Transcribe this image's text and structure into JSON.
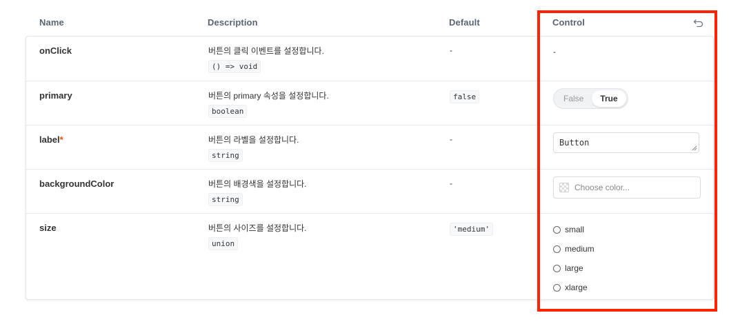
{
  "header": {
    "name": "Name",
    "description": "Description",
    "default": "Default",
    "control": "Control",
    "reset_icon": "undo-icon"
  },
  "rows": [
    {
      "name": "onClick",
      "required": false,
      "description": "버튼의 클릭 이벤트를 설정합니다.",
      "type": "() => void",
      "default": "-",
      "control": {
        "kind": "none",
        "text": "-"
      }
    },
    {
      "name": "primary",
      "required": false,
      "description": "버튼의 primary 속성을 설정합니다.",
      "type": "boolean",
      "default": "false",
      "control": {
        "kind": "toggle",
        "options": [
          "False",
          "True"
        ],
        "selected": "True"
      }
    },
    {
      "name": "label",
      "required": true,
      "required_mark": "*",
      "description": "버튼의 라벨을 설정합니다.",
      "type": "string",
      "default": "-",
      "control": {
        "kind": "text",
        "value": "Button"
      }
    },
    {
      "name": "backgroundColor",
      "required": false,
      "description": "버튼의 배경색을 설정합니다.",
      "type": "string",
      "default": "-",
      "control": {
        "kind": "color",
        "placeholder": "Choose color..."
      }
    },
    {
      "name": "size",
      "required": false,
      "description": "버튼의 사이즈를 설정합니다.",
      "type": "union",
      "default": "'medium'",
      "control": {
        "kind": "radio",
        "options": [
          "small",
          "medium",
          "large",
          "xlarge"
        ],
        "selected": null
      }
    }
  ],
  "colors": {
    "highlight": "#ff2200",
    "required_star": "#ff4400",
    "border": "#e3e6ea"
  }
}
